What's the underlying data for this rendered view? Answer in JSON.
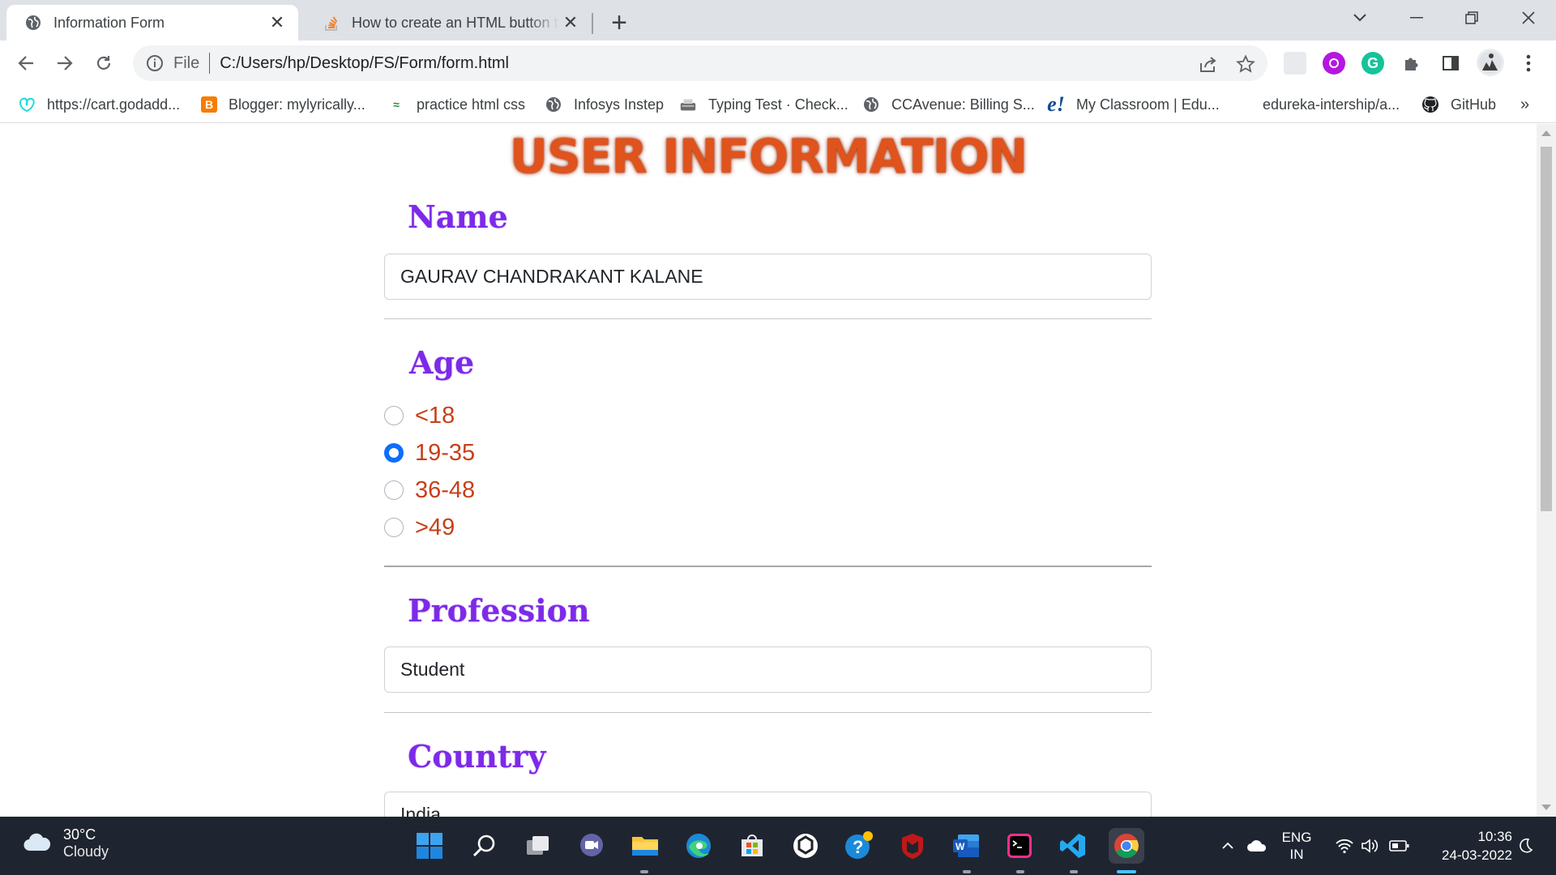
{
  "browser": {
    "tabs": [
      {
        "title": "Information Form",
        "icon": "globe-icon",
        "active": true
      },
      {
        "title": "How to create an HTML button that",
        "icon": "stackoverflow-icon",
        "active": false
      }
    ],
    "new_tab_label": "+",
    "omnibox": {
      "scheme_label": "File",
      "url": "C:/Users/hp/Desktop/FS/Form/form.html"
    },
    "bookmarks": [
      {
        "label": "https://cart.godadd...",
        "icon": "godaddy-icon"
      },
      {
        "label": "Blogger: mylyrically...",
        "icon": "blogger-icon"
      },
      {
        "label": "practice html css",
        "icon": "codepen-icon"
      },
      {
        "label": "Infosys Instep",
        "icon": "globe-icon"
      },
      {
        "label": "Typing Test · Check...",
        "icon": "typewriter-icon"
      },
      {
        "label": "CCAvenue: Billing S...",
        "icon": "globe-icon"
      },
      {
        "label": "My Classroom | Edu...",
        "icon": "edureka-icon"
      },
      {
        "label": "edureka-intership/a...",
        "icon": "none"
      },
      {
        "label": "GitHub",
        "icon": "github-icon"
      }
    ],
    "bookmarks_overflow": "»"
  },
  "form": {
    "heading": "USER INFORMATION",
    "name_label": "Name",
    "name_value": "GAURAV CHANDRAKANT KALANE",
    "age_label": "Age",
    "age_options": [
      {
        "label": "<18",
        "checked": false
      },
      {
        "label": "19-35",
        "checked": true
      },
      {
        "label": "36-48",
        "checked": false
      },
      {
        "label": ">49",
        "checked": false
      }
    ],
    "profession_label": "Profession",
    "profession_value": "Student",
    "country_label": "Country",
    "country_value": "India"
  },
  "colors": {
    "heading": "#e0531d",
    "label": "#7d2ae8",
    "radio_text": "#c7401a",
    "radio_checked": "#0d6efd",
    "taskbar": "#1f2530"
  },
  "taskbar": {
    "weather": {
      "temp": "30°C",
      "condition": "Cloudy"
    },
    "apps": [
      "windows-start-icon",
      "search-icon",
      "task-view-icon",
      "teams-chat-icon",
      "file-explorer-icon",
      "edge-icon",
      "ms-store-icon",
      "chatgpt-like-icon",
      "help-icon",
      "mcafee-icon",
      "word-icon",
      "terminal-icon",
      "vscode-icon",
      "chrome-icon"
    ],
    "language": {
      "line1": "ENG",
      "line2": "IN"
    },
    "time": "10:36",
    "date": "24-03-2022"
  }
}
